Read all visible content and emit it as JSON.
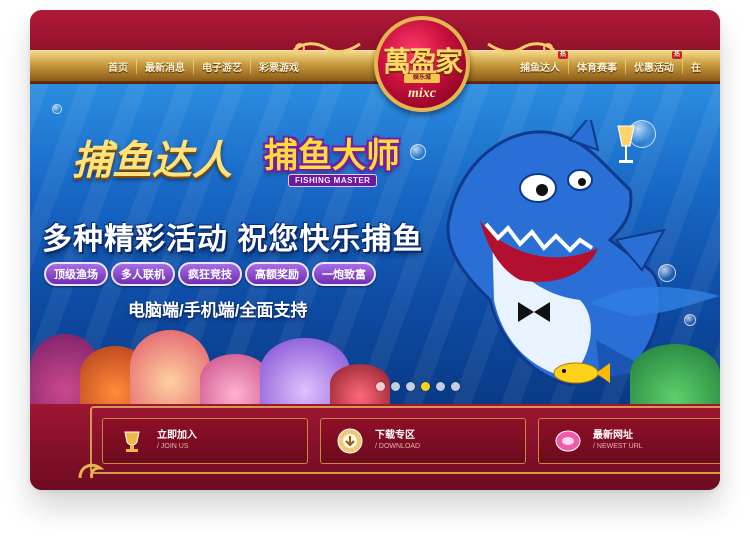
{
  "nav": {
    "left": [
      {
        "label": "首页"
      },
      {
        "label": "最新消息"
      },
      {
        "label": "电子游艺"
      },
      {
        "label": "彩票游戏"
      }
    ],
    "right": [
      {
        "label": "捕鱼达人",
        "badge": "热"
      },
      {
        "label": "体育赛事"
      },
      {
        "label": "优惠活动",
        "badge": "热"
      },
      {
        "label": "在"
      }
    ]
  },
  "logo": {
    "brand": "萬盈家",
    "tag": "娱乐城",
    "sub": "mixc"
  },
  "banner": {
    "title1": "捕鱼达人",
    "title2": "捕鱼大师",
    "title2_sub": "FISHING MASTER",
    "headline": "多种精彩活动 祝您快乐捕鱼",
    "pills": [
      "顶级渔场",
      "多人联机",
      "疯狂竞技",
      "高额奖励",
      "一炮致富"
    ],
    "support": "电脑端/手机端/全面支持",
    "slides": {
      "total": 6,
      "active": 4
    }
  },
  "actions": [
    {
      "title": "立即加入",
      "subtitle": "/ JOIN US",
      "icon": "trophy-icon",
      "color": "#e0a43a"
    },
    {
      "title": "下载专区",
      "subtitle": "/ DOWNLOAD",
      "icon": "download-disc-icon",
      "color": "#efc87a"
    },
    {
      "title": "最新网址",
      "subtitle": "/ NEWEST URL",
      "icon": "web-link-icon",
      "color": "#f05aa8"
    }
  ],
  "colors": {
    "brand_red": "#8c1029",
    "gold": "#e7b54f",
    "ocean": "#1766c4",
    "pill_purple": "#8a4ad0"
  }
}
